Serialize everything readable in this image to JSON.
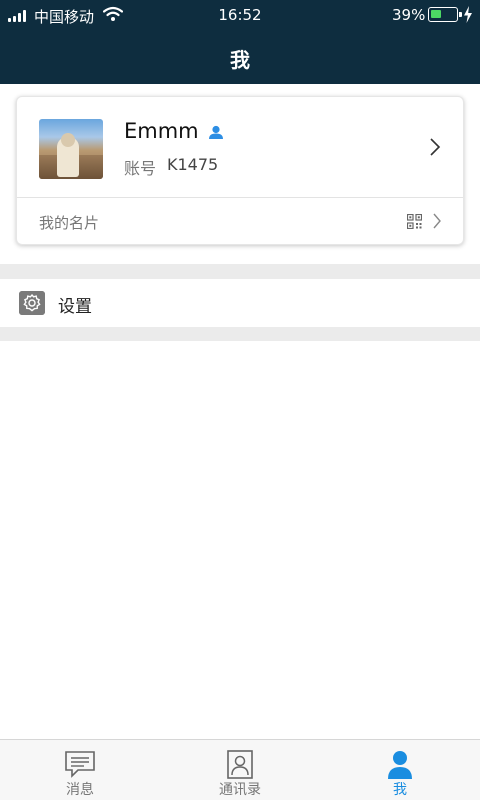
{
  "status_bar": {
    "carrier": "中国移动",
    "time": "16:52",
    "battery_percent": "39%",
    "battery_level": 0.39
  },
  "nav": {
    "title": "我"
  },
  "profile": {
    "name": "Emmm",
    "account_label": "账号",
    "account_value": "K1475",
    "card_link": "我的名片",
    "icons": [
      "avatar",
      "verified-person-icon",
      "chevron-right-icon",
      "qr-code-icon"
    ]
  },
  "settings": {
    "label": "设置",
    "icon": "gear-icon"
  },
  "tabbar": {
    "tabs": [
      {
        "label": "消息",
        "icon": "message-icon",
        "active": false
      },
      {
        "label": "通讯录",
        "icon": "contacts-icon",
        "active": false
      },
      {
        "label": "我",
        "icon": "person-icon",
        "active": true
      }
    ]
  },
  "colors": {
    "header_bg": "#0e2d3f",
    "accent": "#1a8de0",
    "battery_fill": "#4cd964",
    "divider": "#ebebeb"
  }
}
